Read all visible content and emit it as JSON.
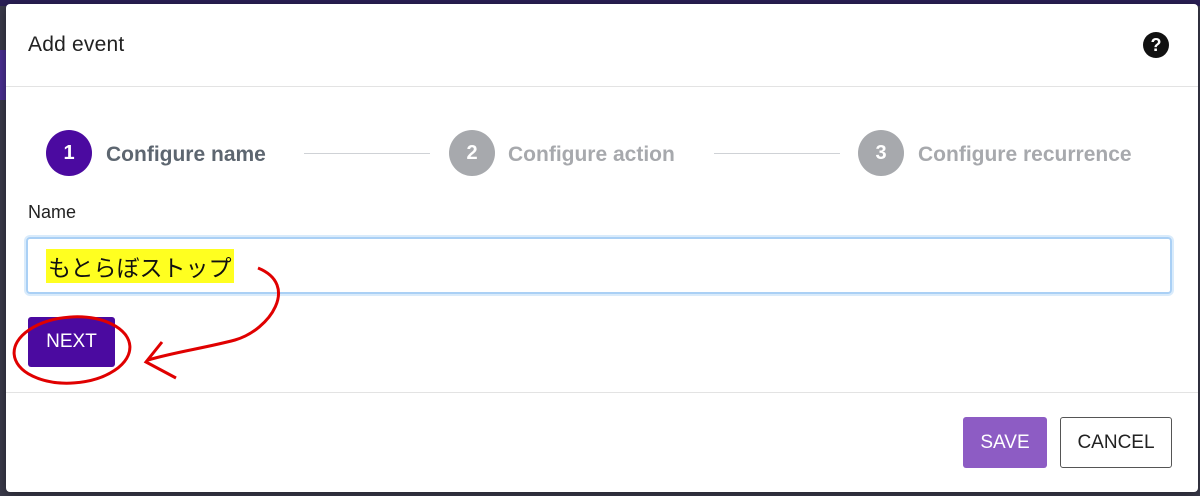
{
  "dialog": {
    "title": "Add event",
    "help_icon": "question-circle-icon",
    "help_glyph": "?"
  },
  "stepper": {
    "steps": [
      {
        "number": "1",
        "label": "Configure name",
        "state": "active"
      },
      {
        "number": "2",
        "label": "Configure action",
        "state": "inactive"
      },
      {
        "number": "3",
        "label": "Configure recurrence",
        "state": "inactive"
      }
    ]
  },
  "form": {
    "name_label": "Name",
    "name_value": "もとらぼストップ",
    "next_label": "NEXT"
  },
  "footer": {
    "save_label": "SAVE",
    "cancel_label": "CANCEL"
  },
  "colors": {
    "primary": "#4b0aa0",
    "save": "#8d5cc4",
    "inactive_step": "#a7a9ad",
    "highlight": "#ffff20",
    "annotation": "#e00000"
  }
}
